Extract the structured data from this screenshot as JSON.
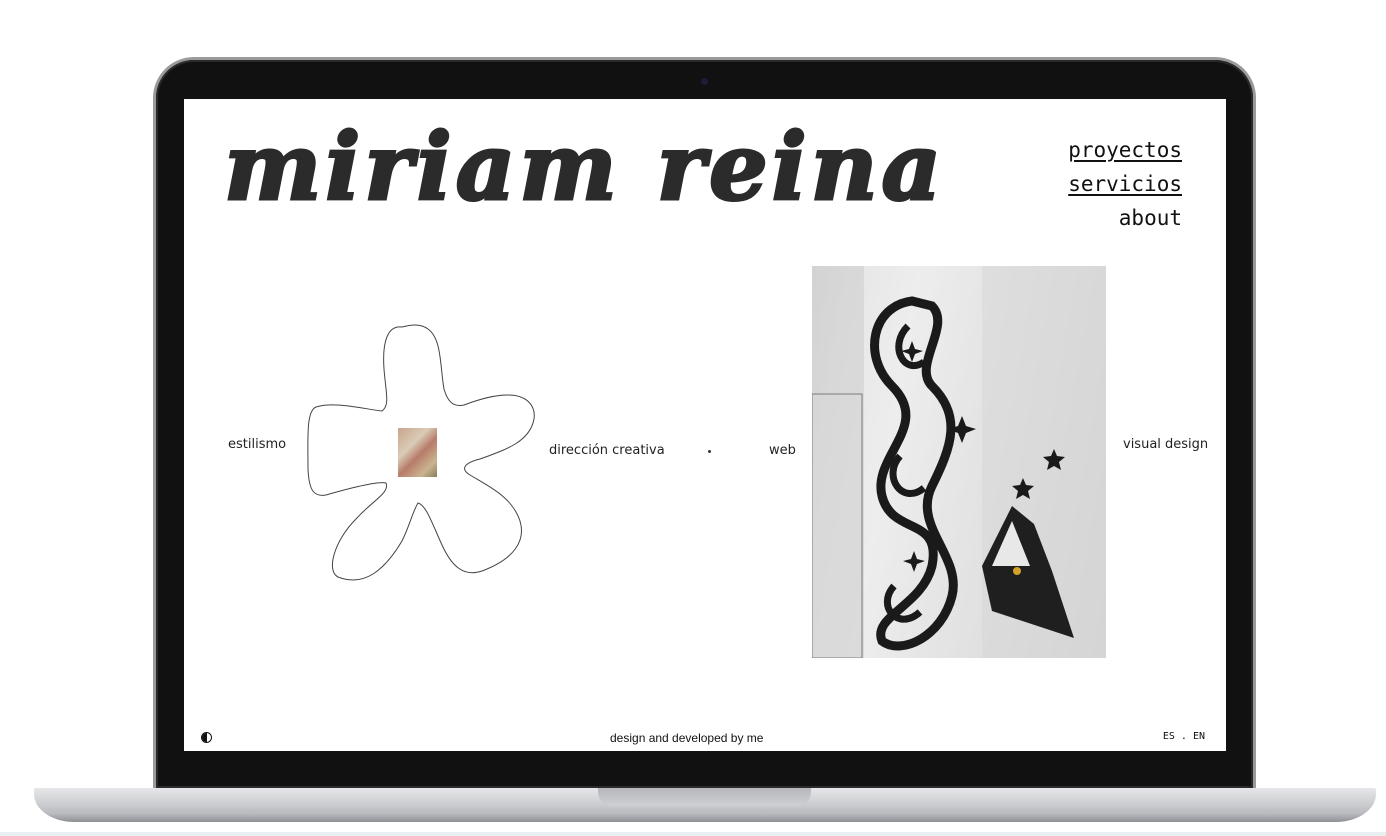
{
  "site": {
    "logo_text": "miriam reina",
    "nav": {
      "proyectos": "proyectos",
      "servicios": "servicios",
      "about": "about"
    },
    "categories": {
      "estilismo": "estilismo",
      "direccion": "dirección creativa",
      "web": "web",
      "visual": "visual design"
    },
    "footer": {
      "credit": "design and developed by me",
      "lang_es": "ES",
      "lang_sep": ".",
      "lang_en": "EN"
    }
  },
  "colors": {
    "laptop_bezel": "#111111",
    "logo": "#2b2b2b",
    "text": "#111111"
  },
  "icons": {
    "theme_toggle": "contrast-icon",
    "camera": "webcam-icon"
  }
}
